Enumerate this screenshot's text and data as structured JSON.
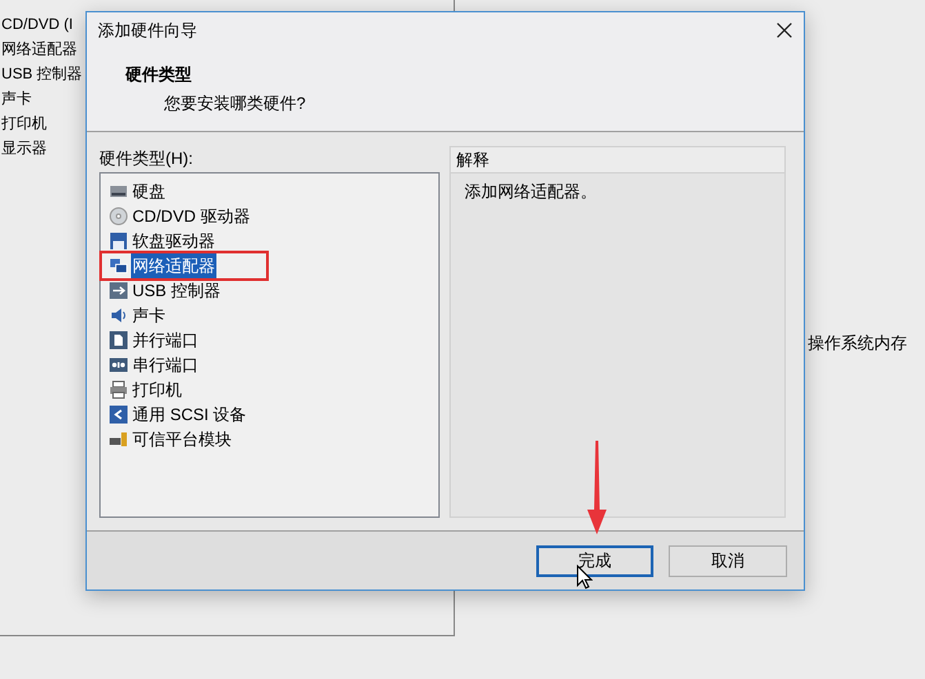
{
  "background_window": {
    "devices": [
      "CD/DVD (I",
      "网络适配器",
      "USB 控制器",
      "声卡",
      "打印机",
      "显示器"
    ],
    "note": "操作系统内存"
  },
  "dialog": {
    "title": "添加硬件向导",
    "heading": "硬件类型",
    "subheading": "您要安装哪类硬件?",
    "list_label": "硬件类型(H):",
    "items": [
      {
        "label": "硬盘",
        "selected": false
      },
      {
        "label": "CD/DVD 驱动器",
        "selected": false
      },
      {
        "label": "软盘驱动器",
        "selected": false
      },
      {
        "label": "网络适配器",
        "selected": true
      },
      {
        "label": "USB 控制器",
        "selected": false
      },
      {
        "label": "声卡",
        "selected": false
      },
      {
        "label": "并行端口",
        "selected": false
      },
      {
        "label": "串行端口",
        "selected": false
      },
      {
        "label": "打印机",
        "selected": false
      },
      {
        "label": "通用 SCSI 设备",
        "selected": false
      },
      {
        "label": "可信平台模块",
        "selected": false
      }
    ],
    "explanation_title": "解释",
    "explanation": "添加网络适配器。",
    "buttons": [
      {
        "label": "完成",
        "kind": "default"
      },
      {
        "label": "取消",
        "kind": "normal"
      }
    ]
  }
}
